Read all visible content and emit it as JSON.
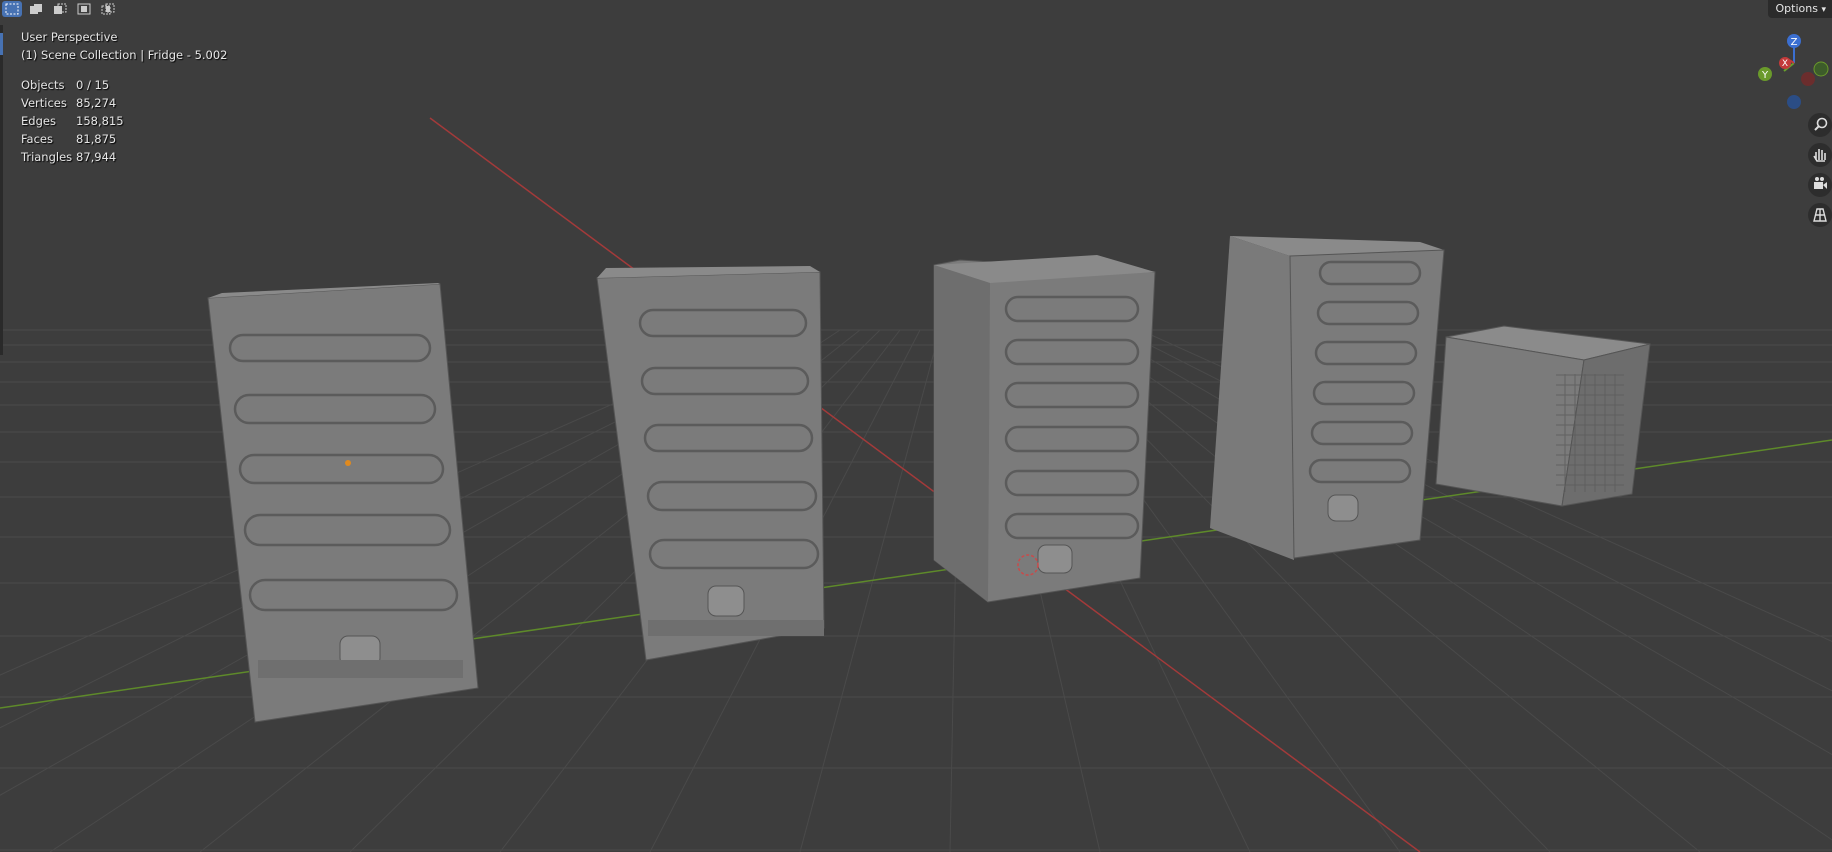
{
  "header": {
    "select_modes": [
      "select-new-icon",
      "select-extend-icon",
      "select-subtract-icon",
      "select-invert-icon",
      "select-intersect-icon"
    ],
    "options_label": "Options"
  },
  "overlay": {
    "view_name": "User Perspective",
    "collection": "(1) Scene Collection | Fridge - 5.002",
    "stats": {
      "objects_label": "Objects",
      "objects_value": "0 / 15",
      "vertices_label": "Vertices",
      "vertices_value": "85,274",
      "edges_label": "Edges",
      "edges_value": "158,815",
      "faces_label": "Faces",
      "faces_value": "81,875",
      "triangles_label": "Triangles",
      "triangles_value": "87,944"
    }
  },
  "gizmo": {
    "z_label": "Z",
    "x_label": "X",
    "y_label": "Y"
  },
  "navigation": [
    "zoom-icon",
    "pan-hand-icon",
    "camera-icon",
    "grid-perspective-icon"
  ],
  "colors": {
    "background": "#3d3d3d",
    "grid": "#494949",
    "x_axis": "#b33a3a",
    "y_axis": "#6a9a2b",
    "model": "#7d7d7d",
    "accent": "#4772b3"
  }
}
